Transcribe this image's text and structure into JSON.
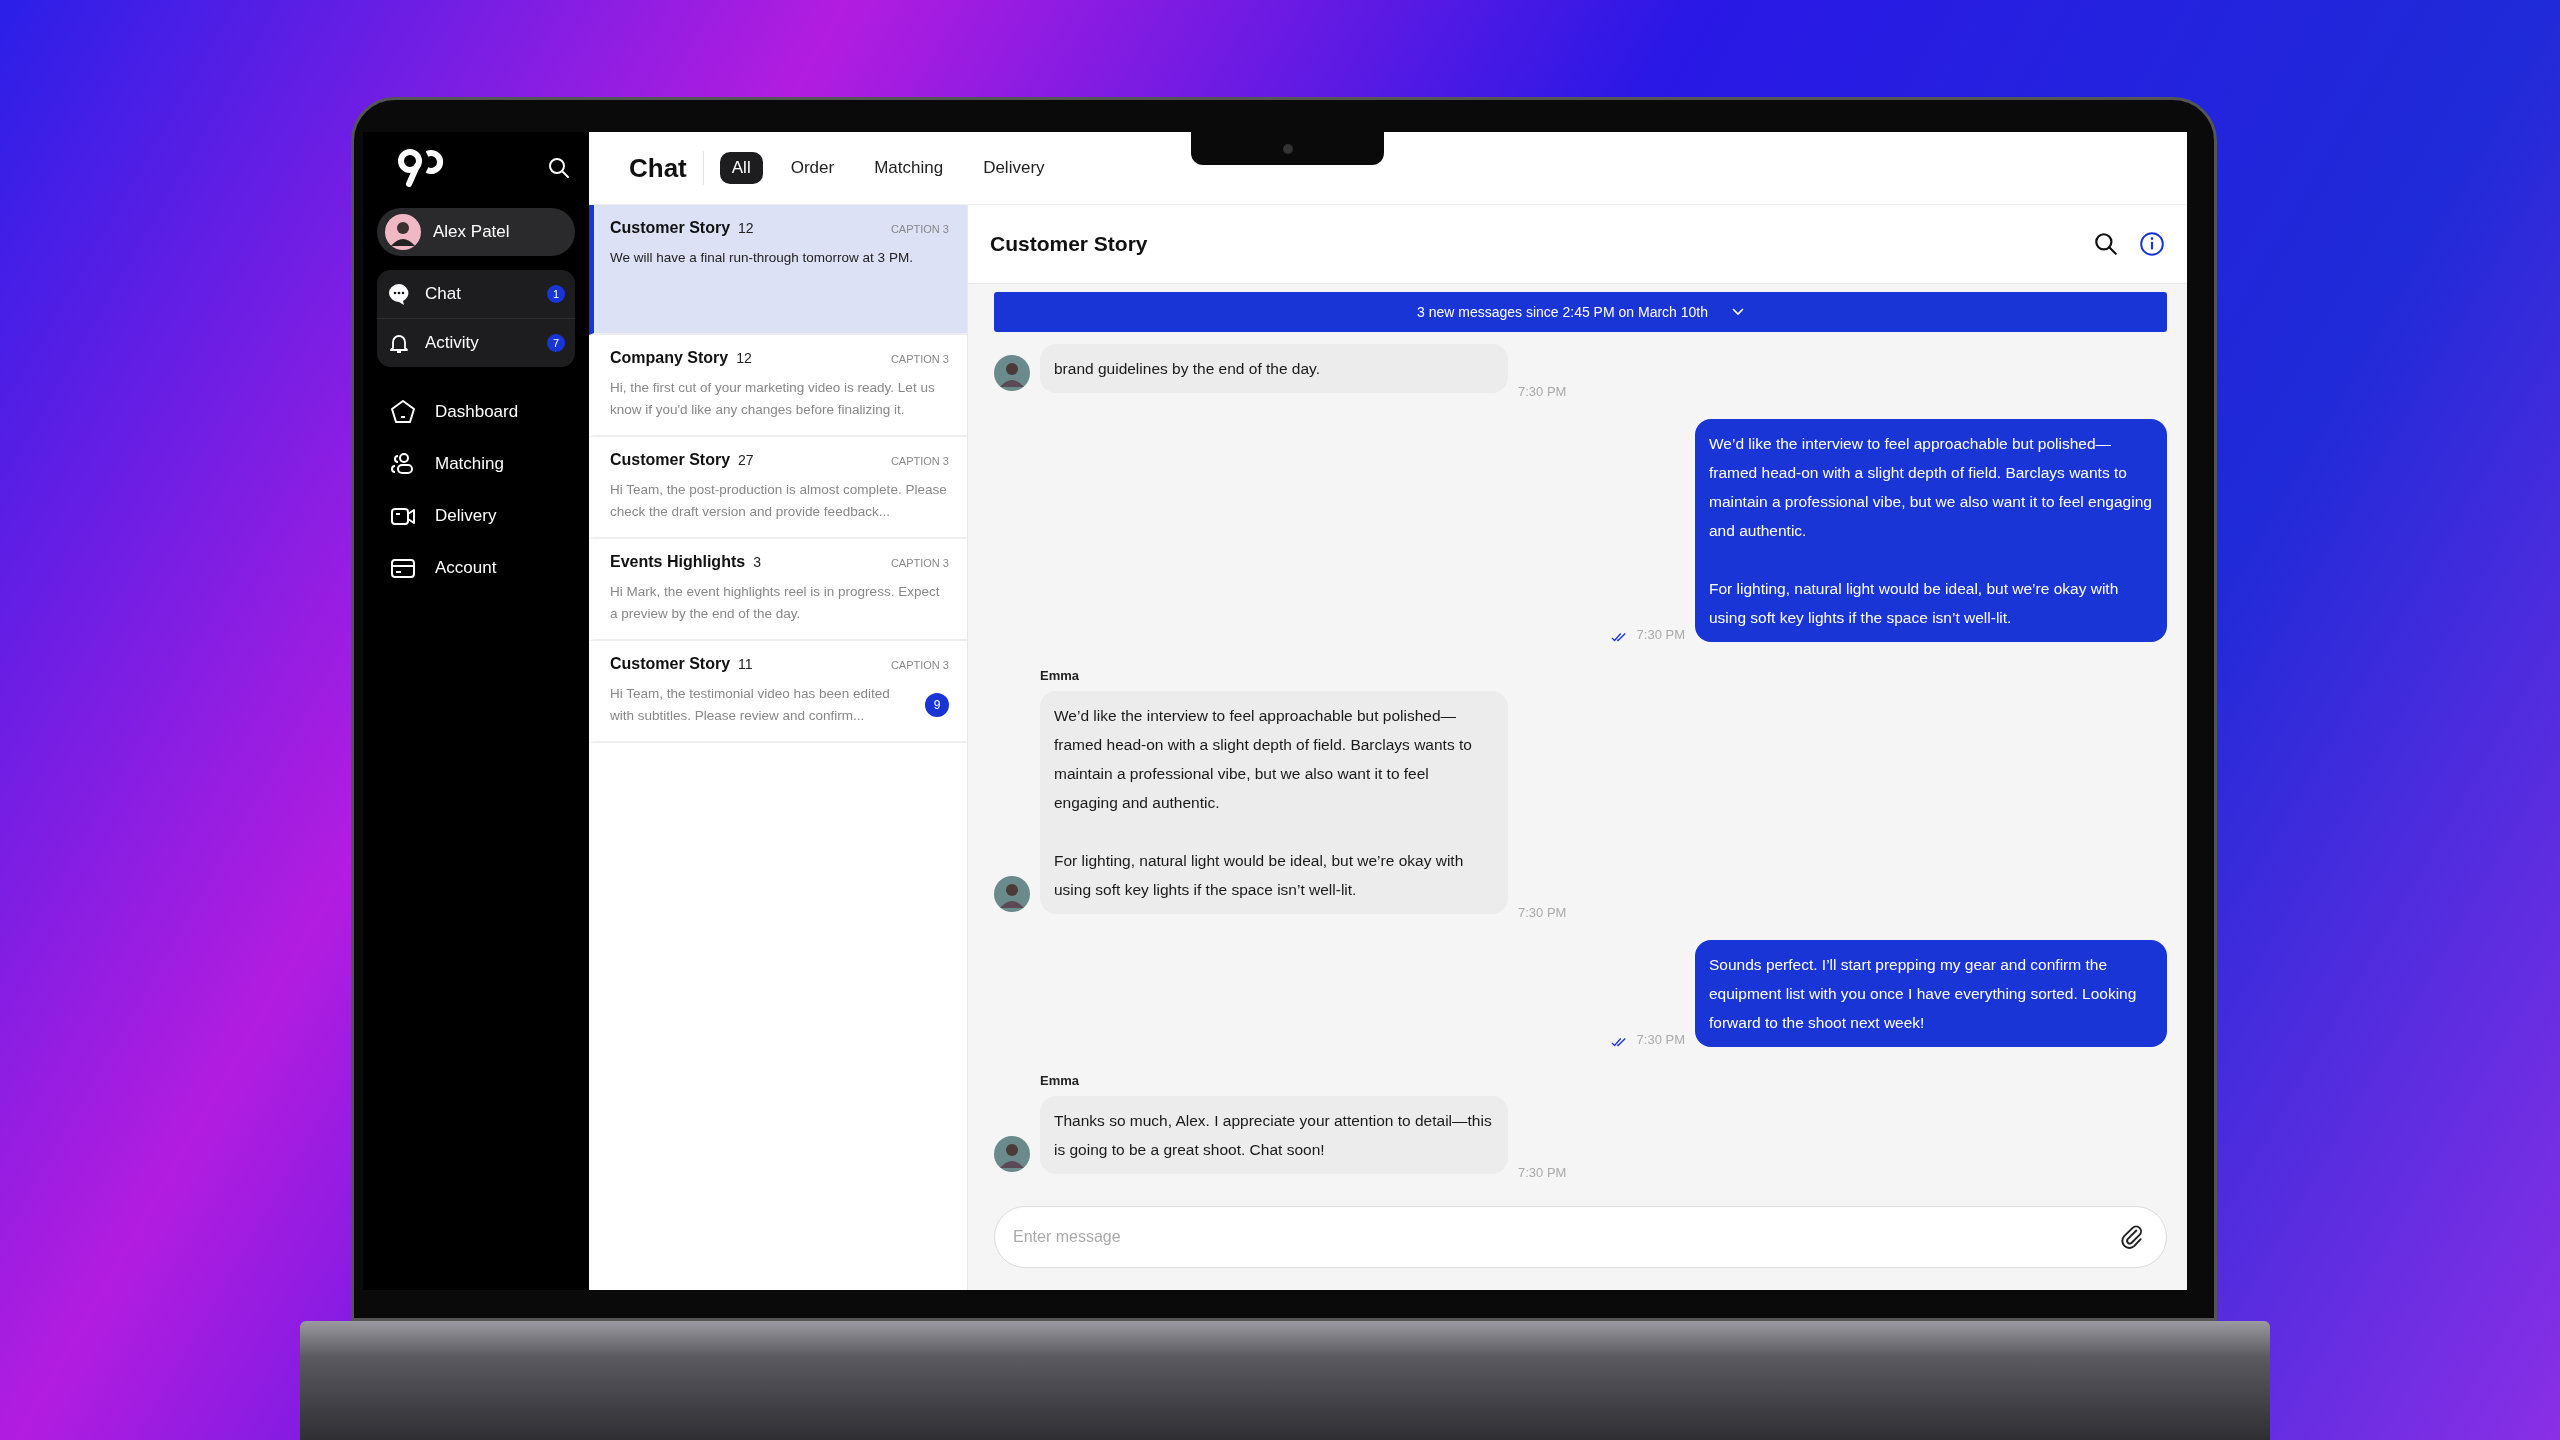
{
  "sidebar": {
    "user": {
      "name": "Alex Patel"
    },
    "inbox_items": [
      {
        "label": "Chat",
        "badge": "1"
      },
      {
        "label": "Activity",
        "badge": "7"
      }
    ],
    "nav_items": [
      {
        "label": "Dashboard"
      },
      {
        "label": "Matching"
      },
      {
        "label": "Delivery"
      },
      {
        "label": "Account"
      }
    ]
  },
  "header": {
    "title": "Chat",
    "tabs": [
      {
        "label": "All",
        "selected": true
      },
      {
        "label": "Order",
        "selected": false
      },
      {
        "label": "Matching",
        "selected": false
      },
      {
        "label": "Delivery",
        "selected": false
      }
    ]
  },
  "conversations": [
    {
      "title": "Customer Story",
      "count": "12",
      "caption": "CAPTION 3",
      "preview": "We will have a final run-through tomorrow at 3 PM.",
      "selected": true
    },
    {
      "title": "Company Story",
      "count": "12",
      "caption": "CAPTION 3",
      "preview": "Hi, the first cut of your marketing video is ready. Let us know if you'd like any changes before finalizing it.",
      "selected": false
    },
    {
      "title": "Customer Story",
      "count": "27",
      "caption": "CAPTION 3",
      "preview": "Hi Team, the post-production is almost complete. Please check the draft version and provide feedback...",
      "selected": false
    },
    {
      "title": "Events Highlights",
      "count": "3",
      "caption": "CAPTION 3",
      "preview": "Hi Mark, the event highlights reel is in progress. Expect a preview by the end of the day.",
      "selected": false
    },
    {
      "title": "Customer Story",
      "count": "11",
      "caption": "CAPTION 3",
      "preview": "Hi Team, the testimonial video has been edited with subtitles. Please review and confirm...",
      "selected": false,
      "unread": "9"
    }
  ],
  "conversation": {
    "title": "Customer Story",
    "banner": "3 new messages since 2:45 PM on March 10th",
    "messages": [
      {
        "kind": "incoming",
        "paragraphs": [
          "brand guidelines by the end of the day."
        ],
        "time": "7:30 PM"
      },
      {
        "kind": "outgoing",
        "paragraphs": [
          "We’d like the interview to feel approachable but polished—framed head-on with a slight depth of field. Barclays wants to maintain a professional vibe, but we also want it to feel engaging and authentic.",
          "For lighting, natural light would be ideal, but we’re okay with using soft key lights if the space isn’t well-lit."
        ],
        "time": "7:30 PM",
        "read": true
      },
      {
        "kind": "incoming",
        "sender": "Emma",
        "paragraphs": [
          "We’d like the interview to feel approachable but polished—framed head-on with a slight depth of field. Barclays wants to maintain a professional vibe, but we also want it to feel engaging and authentic.",
          "For lighting, natural light would be ideal, but we’re okay with using soft key lights if the space isn’t well-lit."
        ],
        "time": "7:30 PM"
      },
      {
        "kind": "outgoing",
        "paragraphs": [
          "Sounds perfect. I’ll start prepping my gear and confirm the equipment list with you once I have everything sorted. Looking forward to the shoot next week!"
        ],
        "time": "7:30 PM",
        "read": true
      },
      {
        "kind": "incoming",
        "sender": "Emma",
        "paragraphs": [
          "Thanks so much, Alex. I appreciate your attention to detail—this is going to be a great shoot. Chat soon!"
        ],
        "time": "7:30 PM"
      }
    ],
    "composer": {
      "placeholder": "Enter message"
    }
  }
}
